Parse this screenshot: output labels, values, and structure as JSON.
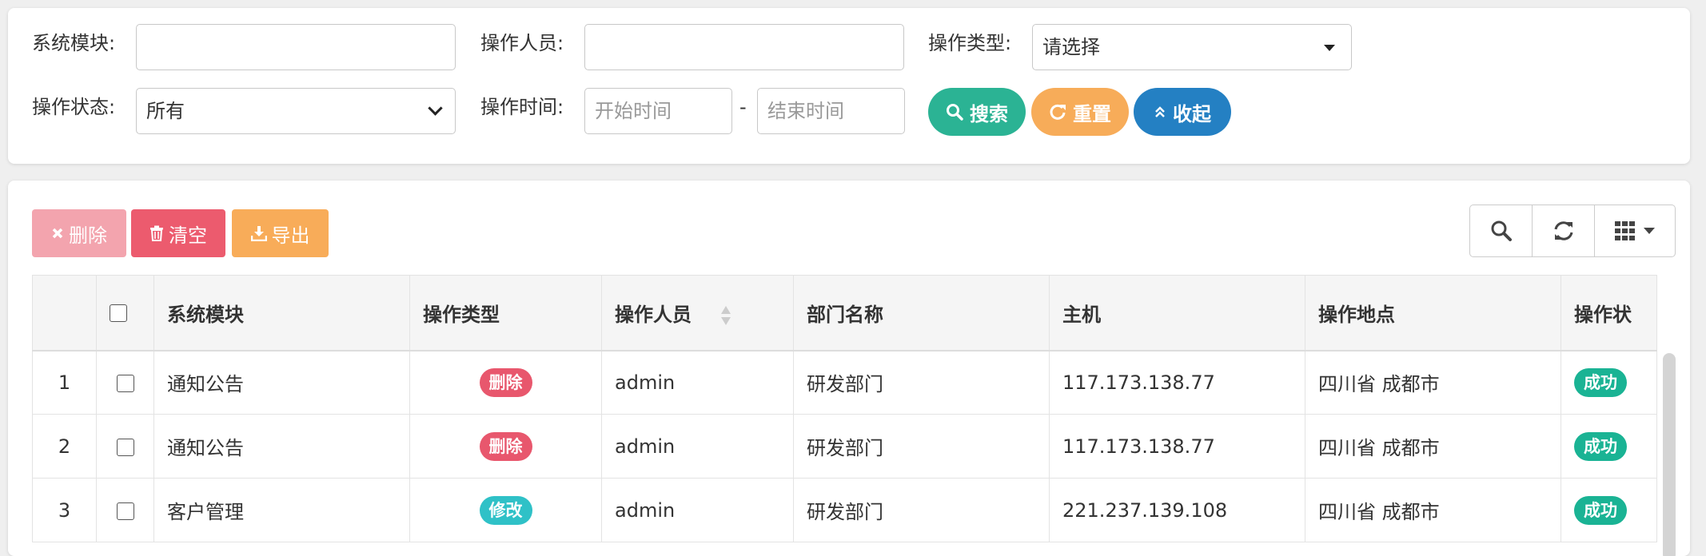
{
  "search": {
    "module_label": "系统模块:",
    "module_value": "",
    "operator_label": "操作人员:",
    "operator_value": "",
    "type_label": "操作类型:",
    "type_selected": "请选择",
    "status_label": "操作状态:",
    "status_selected": "所有",
    "time_label": "操作时间:",
    "start_placeholder": "开始时间",
    "end_placeholder": "结束时间",
    "time_sep": "-",
    "search_button": "搜索",
    "reset_button": "重置",
    "collapse_button": "收起"
  },
  "toolbar": {
    "delete_label": "删除",
    "clear_label": "清空",
    "export_label": "导出"
  },
  "table": {
    "columns": [
      "",
      "",
      "系统模块",
      "操作类型",
      "操作人员",
      "部门名称",
      "主机",
      "操作地点",
      "操作状"
    ],
    "rows": [
      {
        "index": "1",
        "module": "通知公告",
        "type": "删除",
        "type_color": "#e8576d",
        "operator": "admin",
        "dept": "研发部门",
        "host": "117.173.138.77",
        "location": "四川省 成都市",
        "status": "成功"
      },
      {
        "index": "2",
        "module": "通知公告",
        "type": "删除",
        "type_color": "#e8576d",
        "operator": "admin",
        "dept": "研发部门",
        "host": "117.173.138.77",
        "location": "四川省 成都市",
        "status": "成功"
      },
      {
        "index": "3",
        "module": "客户管理",
        "type": "修改",
        "type_color": "#2fc1c7",
        "operator": "admin",
        "dept": "研发部门",
        "host": "221.237.139.108",
        "location": "四川省 成都市",
        "status": "成功"
      }
    ]
  },
  "colors": {
    "search": "#2bb394",
    "reset": "#f7ac59",
    "collapse": "#2480c3",
    "delete_disabled": "#f3a4ae",
    "clear": "#ec5b6e",
    "export": "#f8ac59",
    "status_success": "#1ab394"
  },
  "icons": {
    "search": "search-icon",
    "reset": "refresh-icon",
    "collapse": "double-chevron-up-icon",
    "delete": "times-icon",
    "clear": "trash-icon",
    "export": "download-icon",
    "tool_search": "search-icon",
    "tool_refresh": "refresh-icon",
    "tool_columns": "grid-icon"
  }
}
